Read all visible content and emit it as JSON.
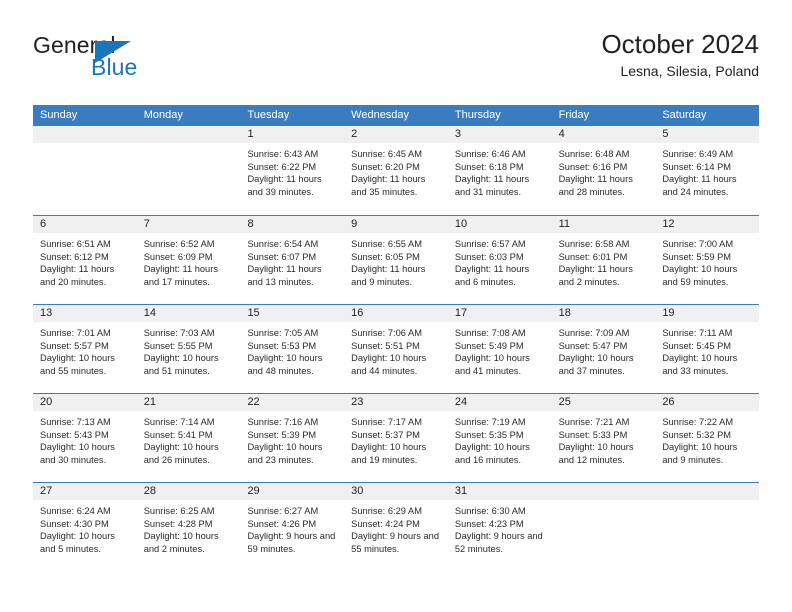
{
  "logo": {
    "word1": "General",
    "word2": "Blue",
    "triangle_color": "#1b75bb"
  },
  "header": {
    "title": "October 2024",
    "location": "Lesna, Silesia, Poland"
  },
  "theme": {
    "header_blue": "#3a7cc0",
    "day_band_gray": "#f0f0f0"
  },
  "weekdays": [
    "Sunday",
    "Monday",
    "Tuesday",
    "Wednesday",
    "Thursday",
    "Friday",
    "Saturday"
  ],
  "weeks": [
    [
      {
        "day": "",
        "sunrise": "",
        "sunset": "",
        "daylight": ""
      },
      {
        "day": "",
        "sunrise": "",
        "sunset": "",
        "daylight": ""
      },
      {
        "day": "1",
        "sunrise": "Sunrise: 6:43 AM",
        "sunset": "Sunset: 6:22 PM",
        "daylight": "Daylight: 11 hours and 39 minutes."
      },
      {
        "day": "2",
        "sunrise": "Sunrise: 6:45 AM",
        "sunset": "Sunset: 6:20 PM",
        "daylight": "Daylight: 11 hours and 35 minutes."
      },
      {
        "day": "3",
        "sunrise": "Sunrise: 6:46 AM",
        "sunset": "Sunset: 6:18 PM",
        "daylight": "Daylight: 11 hours and 31 minutes."
      },
      {
        "day": "4",
        "sunrise": "Sunrise: 6:48 AM",
        "sunset": "Sunset: 6:16 PM",
        "daylight": "Daylight: 11 hours and 28 minutes."
      },
      {
        "day": "5",
        "sunrise": "Sunrise: 6:49 AM",
        "sunset": "Sunset: 6:14 PM",
        "daylight": "Daylight: 11 hours and 24 minutes."
      }
    ],
    [
      {
        "day": "6",
        "sunrise": "Sunrise: 6:51 AM",
        "sunset": "Sunset: 6:12 PM",
        "daylight": "Daylight: 11 hours and 20 minutes."
      },
      {
        "day": "7",
        "sunrise": "Sunrise: 6:52 AM",
        "sunset": "Sunset: 6:09 PM",
        "daylight": "Daylight: 11 hours and 17 minutes."
      },
      {
        "day": "8",
        "sunrise": "Sunrise: 6:54 AM",
        "sunset": "Sunset: 6:07 PM",
        "daylight": "Daylight: 11 hours and 13 minutes."
      },
      {
        "day": "9",
        "sunrise": "Sunrise: 6:55 AM",
        "sunset": "Sunset: 6:05 PM",
        "daylight": "Daylight: 11 hours and 9 minutes."
      },
      {
        "day": "10",
        "sunrise": "Sunrise: 6:57 AM",
        "sunset": "Sunset: 6:03 PM",
        "daylight": "Daylight: 11 hours and 6 minutes."
      },
      {
        "day": "11",
        "sunrise": "Sunrise: 6:58 AM",
        "sunset": "Sunset: 6:01 PM",
        "daylight": "Daylight: 11 hours and 2 minutes."
      },
      {
        "day": "12",
        "sunrise": "Sunrise: 7:00 AM",
        "sunset": "Sunset: 5:59 PM",
        "daylight": "Daylight: 10 hours and 59 minutes."
      }
    ],
    [
      {
        "day": "13",
        "sunrise": "Sunrise: 7:01 AM",
        "sunset": "Sunset: 5:57 PM",
        "daylight": "Daylight: 10 hours and 55 minutes."
      },
      {
        "day": "14",
        "sunrise": "Sunrise: 7:03 AM",
        "sunset": "Sunset: 5:55 PM",
        "daylight": "Daylight: 10 hours and 51 minutes."
      },
      {
        "day": "15",
        "sunrise": "Sunrise: 7:05 AM",
        "sunset": "Sunset: 5:53 PM",
        "daylight": "Daylight: 10 hours and 48 minutes."
      },
      {
        "day": "16",
        "sunrise": "Sunrise: 7:06 AM",
        "sunset": "Sunset: 5:51 PM",
        "daylight": "Daylight: 10 hours and 44 minutes."
      },
      {
        "day": "17",
        "sunrise": "Sunrise: 7:08 AM",
        "sunset": "Sunset: 5:49 PM",
        "daylight": "Daylight: 10 hours and 41 minutes."
      },
      {
        "day": "18",
        "sunrise": "Sunrise: 7:09 AM",
        "sunset": "Sunset: 5:47 PM",
        "daylight": "Daylight: 10 hours and 37 minutes."
      },
      {
        "day": "19",
        "sunrise": "Sunrise: 7:11 AM",
        "sunset": "Sunset: 5:45 PM",
        "daylight": "Daylight: 10 hours and 33 minutes."
      }
    ],
    [
      {
        "day": "20",
        "sunrise": "Sunrise: 7:13 AM",
        "sunset": "Sunset: 5:43 PM",
        "daylight": "Daylight: 10 hours and 30 minutes."
      },
      {
        "day": "21",
        "sunrise": "Sunrise: 7:14 AM",
        "sunset": "Sunset: 5:41 PM",
        "daylight": "Daylight: 10 hours and 26 minutes."
      },
      {
        "day": "22",
        "sunrise": "Sunrise: 7:16 AM",
        "sunset": "Sunset: 5:39 PM",
        "daylight": "Daylight: 10 hours and 23 minutes."
      },
      {
        "day": "23",
        "sunrise": "Sunrise: 7:17 AM",
        "sunset": "Sunset: 5:37 PM",
        "daylight": "Daylight: 10 hours and 19 minutes."
      },
      {
        "day": "24",
        "sunrise": "Sunrise: 7:19 AM",
        "sunset": "Sunset: 5:35 PM",
        "daylight": "Daylight: 10 hours and 16 minutes."
      },
      {
        "day": "25",
        "sunrise": "Sunrise: 7:21 AM",
        "sunset": "Sunset: 5:33 PM",
        "daylight": "Daylight: 10 hours and 12 minutes."
      },
      {
        "day": "26",
        "sunrise": "Sunrise: 7:22 AM",
        "sunset": "Sunset: 5:32 PM",
        "daylight": "Daylight: 10 hours and 9 minutes."
      }
    ],
    [
      {
        "day": "27",
        "sunrise": "Sunrise: 6:24 AM",
        "sunset": "Sunset: 4:30 PM",
        "daylight": "Daylight: 10 hours and 5 minutes."
      },
      {
        "day": "28",
        "sunrise": "Sunrise: 6:25 AM",
        "sunset": "Sunset: 4:28 PM",
        "daylight": "Daylight: 10 hours and 2 minutes."
      },
      {
        "day": "29",
        "sunrise": "Sunrise: 6:27 AM",
        "sunset": "Sunset: 4:26 PM",
        "daylight": "Daylight: 9 hours and 59 minutes."
      },
      {
        "day": "30",
        "sunrise": "Sunrise: 6:29 AM",
        "sunset": "Sunset: 4:24 PM",
        "daylight": "Daylight: 9 hours and 55 minutes."
      },
      {
        "day": "31",
        "sunrise": "Sunrise: 6:30 AM",
        "sunset": "Sunset: 4:23 PM",
        "daylight": "Daylight: 9 hours and 52 minutes."
      },
      {
        "day": "",
        "sunrise": "",
        "sunset": "",
        "daylight": ""
      },
      {
        "day": "",
        "sunrise": "",
        "sunset": "",
        "daylight": ""
      }
    ]
  ]
}
